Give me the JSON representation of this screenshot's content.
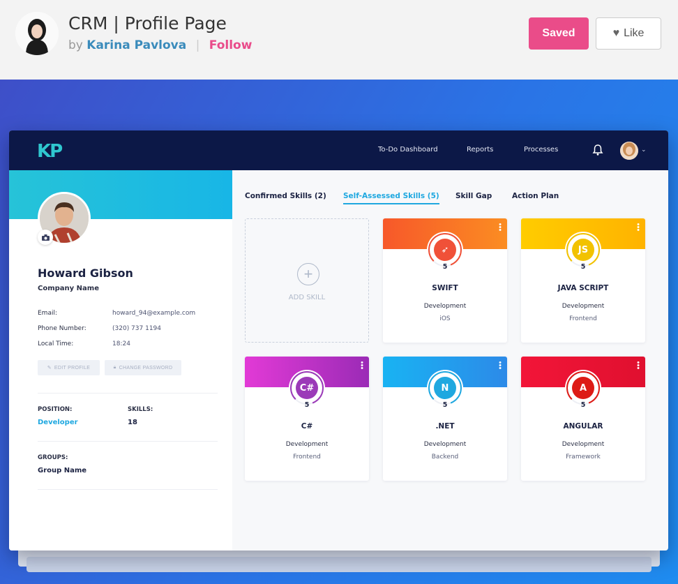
{
  "shot": {
    "title": "CRM | Profile Page",
    "by": "by",
    "author": "Karina Pavlova",
    "separator": "|",
    "follow": "Follow",
    "saved_label": "Saved",
    "like_label": "Like",
    "like_icon_glyph": "♥"
  },
  "app": {
    "logo": "KP",
    "nav": [
      "To-Do Dashboard",
      "Reports",
      "Processes"
    ],
    "chevron_glyph": "⌄"
  },
  "profile": {
    "name": "Howard Gibson",
    "company": "Company Name",
    "fields": [
      {
        "label": "Email:",
        "value": "howard_94@example.com"
      },
      {
        "label": "Phone Number:",
        "value": "(320) 737 1194"
      },
      {
        "label": "Local Time:",
        "value": "18:24"
      }
    ],
    "edit_profile_label": "EDIT PROFILE",
    "change_password_label": "CHANGE PASSWORD",
    "position_label": "POSITION:",
    "position_value": "Developer",
    "skills_label": "SKILLS:",
    "skills_value": "18",
    "groups_label": "GROUPS:",
    "groups_value": "Group Name",
    "accent_color": "#1fa8e0"
  },
  "tabs": [
    {
      "label": "Confirmed Skills (2)",
      "active": false
    },
    {
      "label": "Self-Assessed Skills (5)",
      "active": true
    },
    {
      "label": "Skill Gap",
      "active": false
    },
    {
      "label": "Action Plan",
      "active": false
    }
  ],
  "add_skill": {
    "label": "ADD SKILL",
    "plus_glyph": "+"
  },
  "skills": [
    {
      "name": "SWIFT",
      "level": "5",
      "category": "Development",
      "sub": "iOS",
      "icon": "swift-icon",
      "icon_glyph": "➶",
      "color_from": "#f7582a",
      "color_to": "#fb8d22",
      "icon_bg": "#f05138"
    },
    {
      "name": "JAVA SCRIPT",
      "level": "5",
      "category": "Development",
      "sub": "Frontend",
      "icon": "javascript-icon",
      "icon_glyph": "JS",
      "color_from": "#ffcc00",
      "color_to": "#ffb300",
      "icon_bg": "#f2c200"
    },
    {
      "name": "C#",
      "level": "5",
      "category": "Development",
      "sub": "Frontend",
      "icon": "csharp-icon",
      "icon_glyph": "C#",
      "color_from": "#e23ad6",
      "color_to": "#9b2bb6",
      "icon_bg": "#9b3ab8"
    },
    {
      "name": ".NET",
      "level": "5",
      "category": "Development",
      "sub": "Backend",
      "icon": "dotnet-icon",
      "icon_glyph": "N",
      "color_from": "#19b3f3",
      "color_to": "#2c8ae8",
      "icon_bg": "#1fa8e0"
    },
    {
      "name": "ANGULAR",
      "level": "5",
      "category": "Development",
      "sub": "Framework",
      "icon": "angular-icon",
      "icon_glyph": "A",
      "color_from": "#f21538",
      "color_to": "#e0102f",
      "icon_bg": "#dd1b16"
    }
  ]
}
